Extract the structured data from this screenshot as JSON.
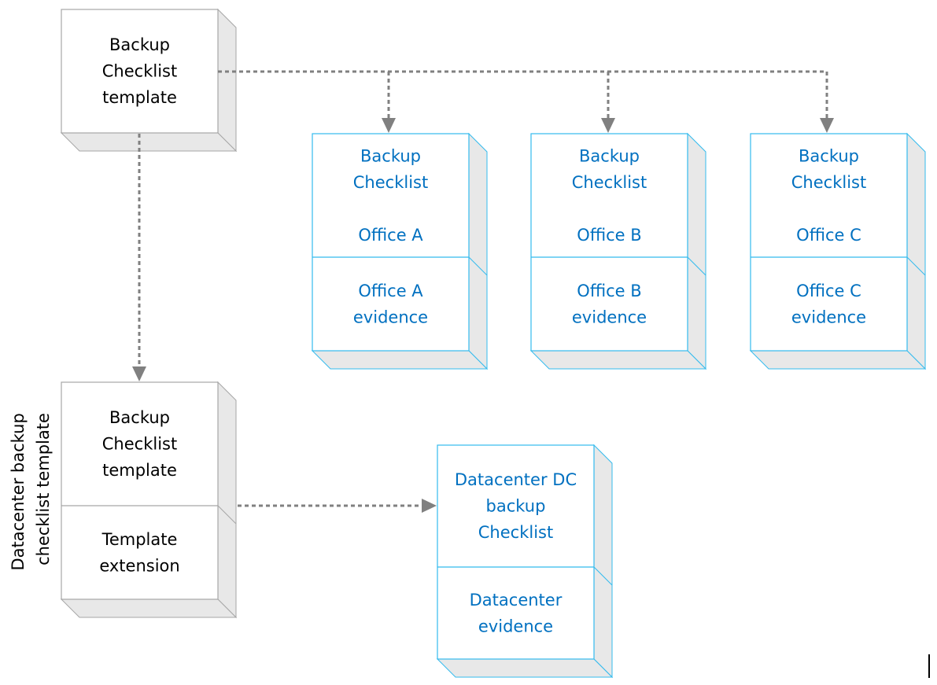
{
  "colors": {
    "template_border": "#a6a6a6",
    "instance_border": "#33bbee",
    "instance_text": "#0070C0",
    "side_fill": "#e8e8e8",
    "arrow": "#808080"
  },
  "template": {
    "lines": [
      "Backup",
      "Checklist",
      "template"
    ]
  },
  "offices": [
    {
      "top": [
        "Backup",
        "Checklist",
        "",
        "Office A"
      ],
      "bottom": [
        "Office A",
        "evidence"
      ]
    },
    {
      "top": [
        "Backup",
        "Checklist",
        "",
        "Office B"
      ],
      "bottom": [
        "Office B",
        "evidence"
      ]
    },
    {
      "top": [
        "Backup",
        "Checklist",
        "",
        "Office C"
      ],
      "bottom": [
        "Office C",
        "evidence"
      ]
    }
  ],
  "dc_template": {
    "side_label": [
      "Datacenter backup",
      "checklist template"
    ],
    "top": [
      "Backup",
      "Checklist",
      "template"
    ],
    "bottom": [
      "Template",
      "extension"
    ]
  },
  "datacenter": {
    "top": [
      "Datacenter DC",
      "backup",
      "Checklist"
    ],
    "bottom": [
      "Datacenter",
      "evidence"
    ]
  }
}
